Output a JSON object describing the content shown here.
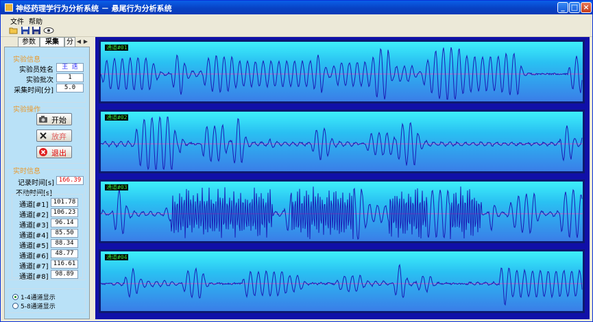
{
  "window": {
    "title": "神经药理学行为分析系统 － 悬尾行为分析系统",
    "minimize_label": "_",
    "maximize_label": "□",
    "close_label": "×"
  },
  "menu": {
    "file_label": "文件",
    "help_label": "帮助"
  },
  "toolbar": {
    "icons": [
      "open-folder-icon",
      "save-icon",
      "save-all-icon",
      "eye-icon"
    ]
  },
  "tabs": {
    "items": [
      "参数",
      "采集",
      "分"
    ],
    "active": "采集",
    "scroll_left": "◀",
    "scroll_right": "▶"
  },
  "experiment_info": {
    "title": "实验信息",
    "operator_label": "实验员姓名",
    "operator_value": "王 迭",
    "batch_label": "实验批次",
    "batch_value": "1",
    "duration_label": "采集时间[分]",
    "duration_value": "5.0"
  },
  "experiment_ops": {
    "title": "实验操作",
    "start_label": "开始",
    "abandon_label": "放弃",
    "exit_label": "退出"
  },
  "realtime": {
    "title": "实时信息",
    "record_time_label": "记录时间[s]",
    "record_time_value": "166.39",
    "immobile_label": "不动时间[s]",
    "channels": [
      {
        "label": "通道[#1]",
        "value": "101.78"
      },
      {
        "label": "通道[#2]",
        "value": "106.23"
      },
      {
        "label": "通道[#3]",
        "value": "96.14"
      },
      {
        "label": "通道[#4]",
        "value": "85.50"
      },
      {
        "label": "通道[#5]",
        "value": "88.34"
      },
      {
        "label": "通道[#6]",
        "value": "48.77"
      },
      {
        "label": "通道[#7]",
        "value": "116.61"
      },
      {
        "label": "通道[#8]",
        "value": "98.89"
      }
    ]
  },
  "display": {
    "option1": "1-4通道显示",
    "option2": "5-8通道显示",
    "selected": "1-4通道显示"
  },
  "channels": [
    {
      "label": "通道#01"
    },
    {
      "label": "通道#02"
    },
    {
      "label": "通道#03"
    },
    {
      "label": "通道#04"
    }
  ],
  "colors": {
    "waveform": "#1a1ab4",
    "baseline": "#d060c0",
    "group_title": "#e89a30",
    "record_time_text": "#e00000",
    "plot_background_top": "#3ef0fa",
    "plot_background_bottom": "#3a7ee8"
  }
}
